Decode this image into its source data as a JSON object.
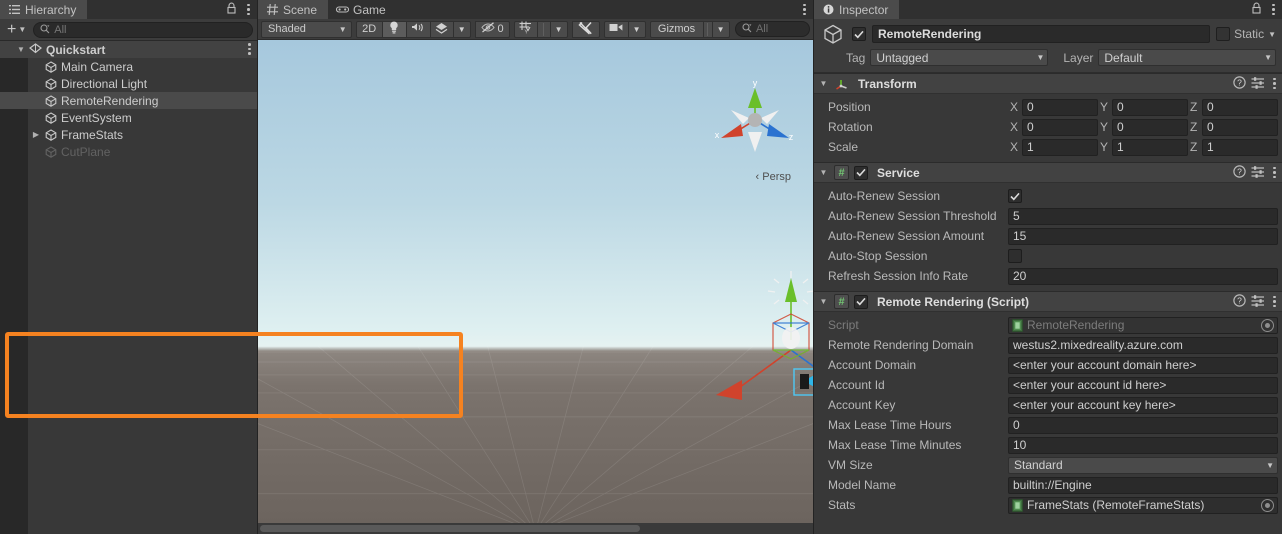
{
  "hierarchy": {
    "tab_label": "Hierarchy",
    "tab_icon": "hierarchy-icon",
    "lock_icon": "lock-icon",
    "menu_icon": "kebab-menu-icon",
    "add_label": "+",
    "search": {
      "placeholder": "All",
      "value": "",
      "icon": "search-icon"
    },
    "items": [
      {
        "label": "Quickstart",
        "icon": "scene-icon",
        "indent": 1,
        "foldout": "▼",
        "selected": false,
        "root": true,
        "dim": false
      },
      {
        "label": "Main Camera",
        "icon": "gameobject-icon",
        "indent": 2,
        "foldout": "",
        "selected": false,
        "root": false,
        "dim": false
      },
      {
        "label": "Directional Light",
        "icon": "gameobject-icon",
        "indent": 2,
        "foldout": "",
        "selected": false,
        "root": false,
        "dim": false
      },
      {
        "label": "RemoteRendering",
        "icon": "gameobject-icon",
        "indent": 2,
        "foldout": "",
        "selected": true,
        "root": false,
        "dim": false
      },
      {
        "label": "EventSystem",
        "icon": "gameobject-icon",
        "indent": 2,
        "foldout": "",
        "selected": false,
        "root": false,
        "dim": false
      },
      {
        "label": "FrameStats",
        "icon": "gameobject-icon",
        "indent": 2,
        "foldout": "▶",
        "selected": false,
        "root": false,
        "dim": false
      },
      {
        "label": "CutPlane",
        "icon": "gameobject-icon",
        "indent": 2,
        "foldout": "",
        "selected": false,
        "root": false,
        "dim": true
      }
    ]
  },
  "scene": {
    "tabs": [
      {
        "label": "Scene",
        "icon": "grid-icon",
        "active": true
      },
      {
        "label": "Game",
        "icon": "gamepad-icon",
        "active": false
      }
    ],
    "menu_icon": "kebab-menu-icon",
    "toolbar": {
      "draw_mode": "Shaded",
      "two_d": "2D",
      "lighting_icon": "lightbulb-icon",
      "audio_icon": "speaker-icon",
      "fx_icon": "fx-icon",
      "hidden_objects_count": "0",
      "hidden_objects_icon": "eye-off-icon",
      "grid_icon": "grid-visibility-icon",
      "tools_icon": "scene-tools-icon",
      "camera_icon": "camera-icon",
      "gizmos_label": "Gizmos",
      "search": {
        "placeholder": "All",
        "value": "",
        "icon": "search-icon"
      }
    },
    "viewport": {
      "persp_label": "Persp",
      "persp_prefix": "‹",
      "gizmo_axes": {
        "x": "x",
        "y": "y",
        "z": "z"
      },
      "colors": {
        "x_axis": "#d0432c",
        "y_axis": "#6abf2a",
        "z_axis": "#2a72d0",
        "selection": "#4ec9f5"
      }
    }
  },
  "inspector": {
    "tab_label": "Inspector",
    "tab_icon": "info-icon",
    "lock_icon": "lock-icon",
    "menu_icon": "kebab-menu-icon",
    "object": {
      "enabled": true,
      "icon": "gameobject-icon",
      "name": "RemoteRendering",
      "static_label": "Static",
      "static_checked": false,
      "tag_label": "Tag",
      "tag_value": "Untagged",
      "layer_label": "Layer",
      "layer_value": "Default"
    },
    "components": [
      {
        "title": "Transform",
        "icon": "transform-icon",
        "has_enable_checkbox": false,
        "help_icon": "help-icon",
        "preset_icon": "preset-icon",
        "menu_icon": "kebab-menu-icon",
        "rows": [
          {
            "type": "vector3",
            "label": "Position",
            "axes": [
              "X",
              "Y",
              "Z"
            ],
            "values": [
              "0",
              "0",
              "0"
            ]
          },
          {
            "type": "vector3",
            "label": "Rotation",
            "axes": [
              "X",
              "Y",
              "Z"
            ],
            "values": [
              "0",
              "0",
              "0"
            ]
          },
          {
            "type": "vector3",
            "label": "Scale",
            "axes": [
              "X",
              "Y",
              "Z"
            ],
            "values": [
              "1",
              "1",
              "1"
            ]
          }
        ]
      },
      {
        "title": "Service",
        "icon": "cs-script-icon",
        "has_enable_checkbox": true,
        "enabled": true,
        "help_icon": "help-icon",
        "preset_icon": "preset-icon",
        "menu_icon": "kebab-menu-icon",
        "rows": [
          {
            "type": "checkbox",
            "label": "Auto-Renew Session",
            "checked": true
          },
          {
            "type": "text",
            "label": "Auto-Renew Session Threshold",
            "value": "5"
          },
          {
            "type": "text",
            "label": "Auto-Renew Session Amount",
            "value": "15"
          },
          {
            "type": "checkbox",
            "label": "Auto-Stop Session",
            "checked": false
          },
          {
            "type": "text",
            "label": "Refresh Session Info Rate",
            "value": "20"
          }
        ]
      },
      {
        "title": "Remote Rendering (Script)",
        "icon": "cs-script-icon",
        "has_enable_checkbox": true,
        "enabled": true,
        "help_icon": "help-icon",
        "preset_icon": "preset-icon",
        "menu_icon": "kebab-menu-icon",
        "rows": [
          {
            "type": "object",
            "label": "Script",
            "value": "RemoteRendering",
            "disabled": true,
            "picker_icon": "object-picker-icon"
          },
          {
            "type": "text",
            "label": "Remote Rendering Domain",
            "value": "westus2.mixedreality.azure.com"
          },
          {
            "type": "text",
            "label": "Account Domain",
            "value": "<enter your account domain here>"
          },
          {
            "type": "text",
            "label": "Account Id",
            "value": "<enter your account id here>"
          },
          {
            "type": "text",
            "label": "Account Key",
            "value": "<enter your account key here>"
          },
          {
            "type": "text",
            "label": "Max Lease Time Hours",
            "value": "0"
          },
          {
            "type": "text",
            "label": "Max Lease Time Minutes",
            "value": "10"
          },
          {
            "type": "dropdown",
            "label": "VM Size",
            "value": "Standard"
          },
          {
            "type": "text",
            "label": "Model Name",
            "value": "builtin://Engine"
          },
          {
            "type": "object",
            "label": "Stats",
            "value": "FrameStats (RemoteFrameStats)",
            "disabled": false,
            "picker_icon": "object-picker-icon"
          }
        ]
      }
    ],
    "highlight": {
      "color": "#f58220",
      "label": "account-credentials-highlight"
    }
  }
}
